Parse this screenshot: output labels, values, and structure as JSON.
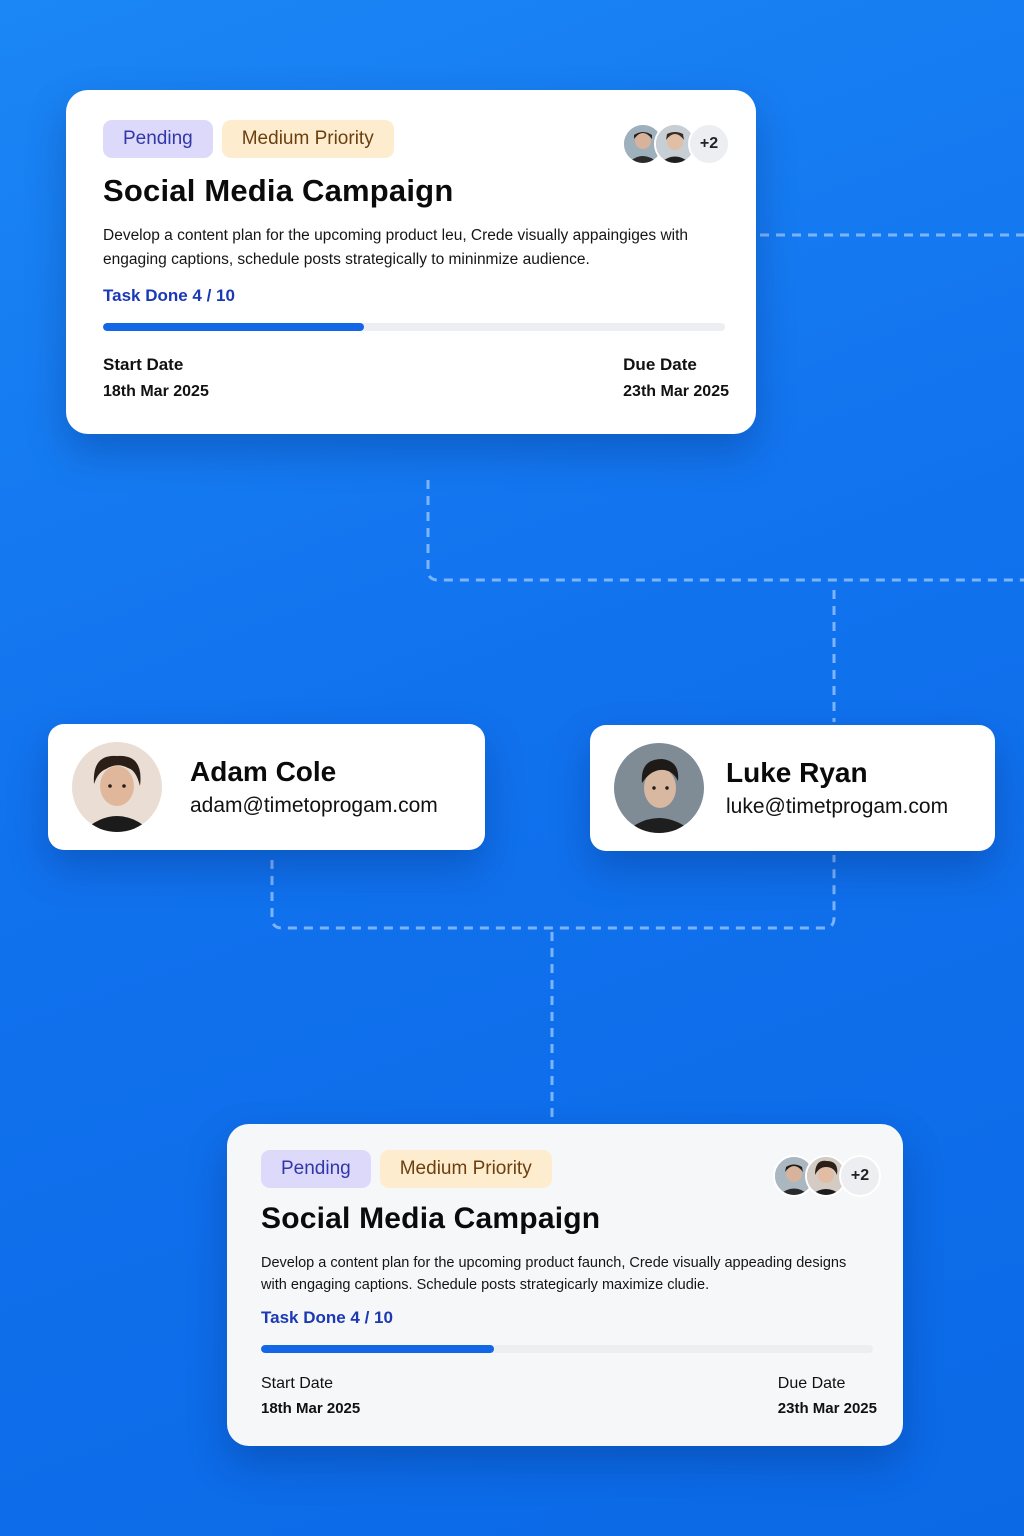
{
  "colors": {
    "background": "#1172ee",
    "pending_bg": "#dcd9fb",
    "priority_bg": "#fdedce",
    "accent": "#1366e6",
    "progress_label": "#1b39b5"
  },
  "task_top": {
    "status": "Pending",
    "priority": "Medium Priority",
    "assignee_extra": "+2",
    "title": "Social Media Campaign",
    "description": "Develop a content plan for the upcoming product leu, Crede visually appaingiges with engaging captions, schedule posts strategically to mininmize audience.",
    "progress_label": "Task Done 4 / 10",
    "progress_fraction": 0.42,
    "start_label": "Start Date",
    "start_value": "18th Mar 2025",
    "due_label": "Due Date",
    "due_value": "23th Mar 2025"
  },
  "people": [
    {
      "name": "Adam Cole",
      "email": "adam@timetoprogam.com"
    },
    {
      "name": "Luke Ryan",
      "email": "luke@timetprogam.com"
    }
  ],
  "task_bottom": {
    "status": "Pending",
    "priority": "Medium Priority",
    "assignee_extra": "+2",
    "title": "Social Media Campaign",
    "description": "Develop a content plan for the upcoming product faunch, Crede visually appeading designs with engaging captions. Schedule posts strategicarly maximize cludie.",
    "progress_label": "Task Done 4 / 10",
    "progress_fraction": 0.38,
    "start_label": "Start Date",
    "start_value": "18th Mar 2025",
    "due_label": "Due Date",
    "due_value": "23th Mar 2025"
  }
}
